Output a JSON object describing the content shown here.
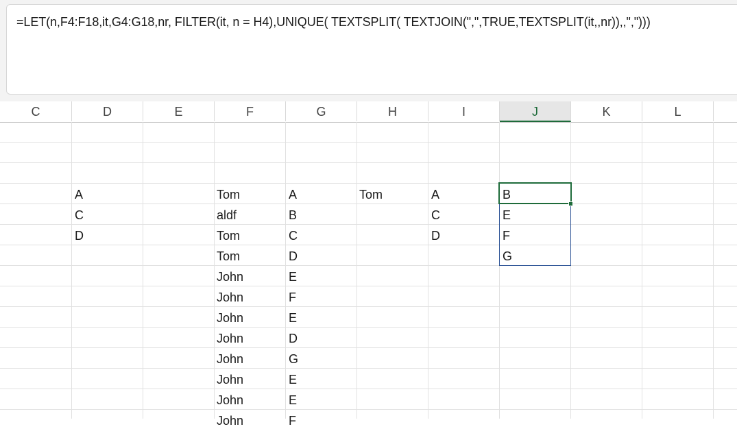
{
  "formula_bar": {
    "formula": "=LET(n,F4:F18,it,G4:G18,nr, FILTER(it, n = H4),UNIQUE( TEXTSPLIT( TEXTJOIN(\",\",TRUE,TEXTSPLIT(it,,nr)),,\",\")))"
  },
  "columns": [
    "C",
    "D",
    "E",
    "F",
    "G",
    "H",
    "I",
    "J",
    "K",
    "L"
  ],
  "active_column": "J",
  "cells": {
    "D": [
      "A",
      "C",
      "D"
    ],
    "F": [
      "Tom",
      "aldf",
      "Tom",
      "Tom",
      "John",
      "John",
      "John",
      "John",
      "John",
      "John",
      "John",
      "John"
    ],
    "G": [
      "A",
      "B",
      "C",
      "D",
      "E",
      "F",
      "E",
      "D",
      "G",
      "E",
      "E",
      "F"
    ],
    "H": [
      "Tom"
    ],
    "I": [
      "A",
      "C",
      "D"
    ],
    "J": [
      "B",
      "E",
      "F",
      "G"
    ]
  },
  "colors": {
    "active_cell_border": "#1e6b3a",
    "spill_border": "#2f5597"
  }
}
